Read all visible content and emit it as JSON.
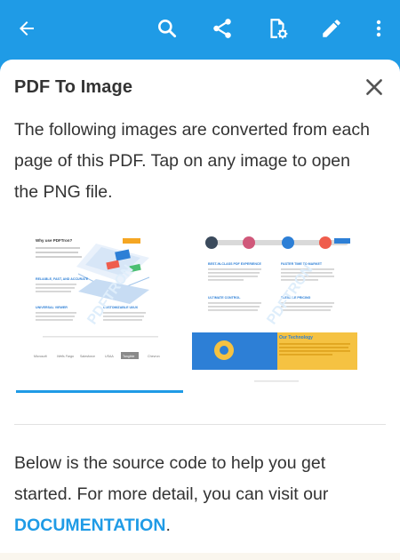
{
  "toolbar": {
    "icons": [
      "back-arrow-icon",
      "search-icon",
      "share-icon",
      "file-settings-icon",
      "edit-pencil-icon",
      "more-vertical-icon"
    ],
    "bg_color": "#1f9be6"
  },
  "sheet": {
    "title": "PDF To Image",
    "intro": "The following images are converted from each page of this PDF. Tap on any image to open the PNG file.",
    "source_text": "Below is the source code to help you get started. For more detail, you can visit our",
    "link_label": "DOCUMENTATION",
    "link_suffix": ".",
    "accent_color": "#1f9be6"
  },
  "thumbnails": [
    {
      "page": 1,
      "selected": true,
      "heading": "Why use PDFTron?",
      "sections": [
        "RELIABLE, FAST, AND ACCURATE",
        "UNIVERSAL VIEWER",
        "CUSTOMIZABLE UI/UX"
      ],
      "logos": [
        "Microsoft",
        "Wells Fargo",
        "Salesforce",
        "USAA",
        "Tangible",
        "Chevron"
      ]
    },
    {
      "page": 2,
      "selected": false,
      "sections": [
        "BEST-IN-CLASS PDF EXPERIENCE",
        "FASTER TIME TO MARKET",
        "ULTIMATE CONTROL",
        "FLEXIBLE PRICING"
      ],
      "callout_title": "Our Technology"
    }
  ]
}
